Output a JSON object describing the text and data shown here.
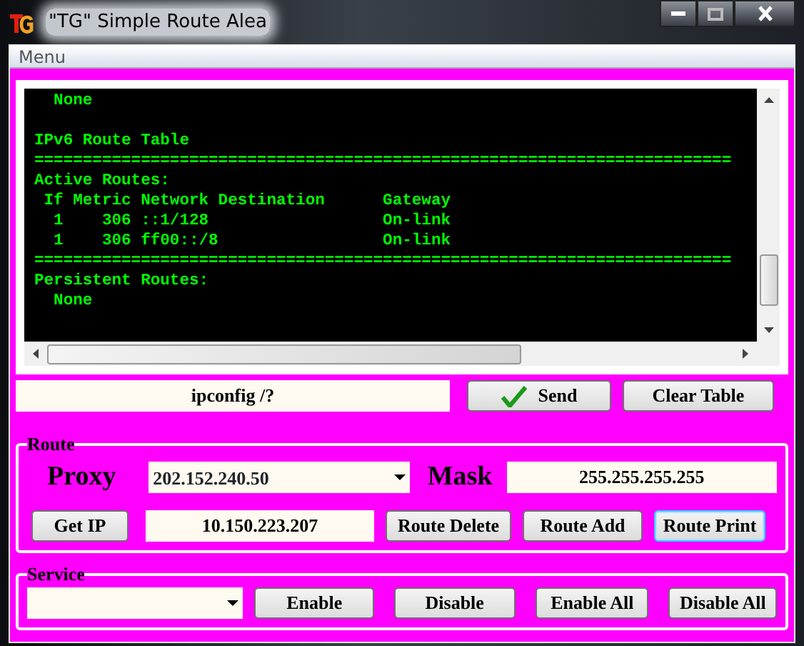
{
  "window": {
    "title": "\"TG\"  Simple Route  Alea"
  },
  "menu": [
    "Menu"
  ],
  "console": {
    "blocks": [
      [
        "  None"
      ],
      [
        "IPv6 Route Table",
        "========================================================================",
        "Active Routes:",
        " If Metric Network Destination      Gateway",
        "  1    306 ::1/128                  On-link",
        "  1    306 ff00::/8                 On-link",
        "========================================================================",
        "Persistent Routes:",
        "  None"
      ]
    ]
  },
  "command": {
    "value": "ipconfig /?",
    "send": "Send",
    "clear": "Clear Table"
  },
  "route": {
    "legend": "Route",
    "proxy_label": "Proxy",
    "proxy": "202.152.240.50",
    "mask_label": "Mask",
    "mask": "255.255.255.255",
    "get_ip": "Get IP",
    "ip": "10.150.223.207",
    "buttons": [
      {
        "label": "Route Delete",
        "focused": false
      },
      {
        "label": "Route Add",
        "focused": false
      },
      {
        "label": "Route Print",
        "focused": true
      }
    ]
  },
  "service": {
    "legend": "Service",
    "buttons": [
      "Enable",
      "Disable",
      "Enable All",
      "Disable All"
    ]
  }
}
